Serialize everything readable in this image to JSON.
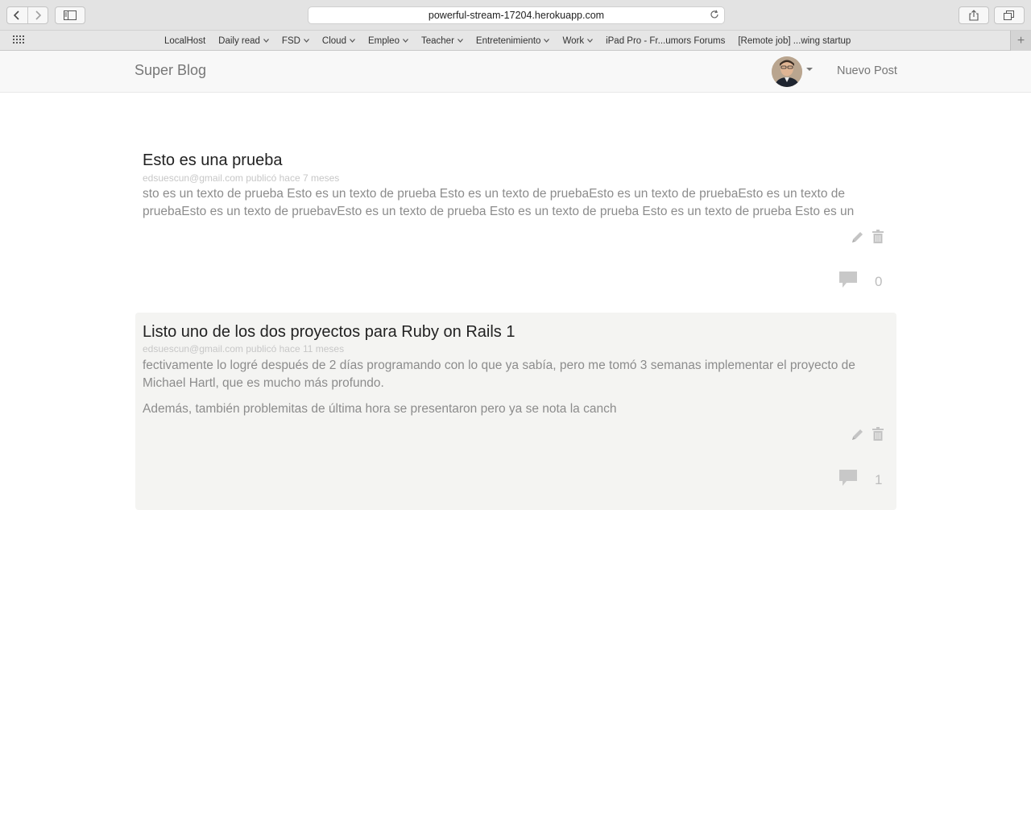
{
  "browser": {
    "url": "powerful-stream-17204.herokuapp.com",
    "bookmarks": [
      {
        "label": "LocalHost",
        "has_menu": false
      },
      {
        "label": "Daily read",
        "has_menu": true
      },
      {
        "label": "FSD",
        "has_menu": true
      },
      {
        "label": "Cloud",
        "has_menu": true
      },
      {
        "label": "Empleo",
        "has_menu": true
      },
      {
        "label": "Teacher",
        "has_menu": true
      },
      {
        "label": "Entretenimiento",
        "has_menu": true
      },
      {
        "label": "Work",
        "has_menu": true
      },
      {
        "label": "iPad Pro - Fr...umors Forums",
        "has_menu": false
      },
      {
        "label": "[Remote job] ...wing startup",
        "has_menu": false
      }
    ]
  },
  "app": {
    "brand": "Super Blog",
    "new_post_label": "Nuevo Post"
  },
  "posts": [
    {
      "title": "Esto es una prueba",
      "meta": "edsuescun@gmail.com publicó hace 7 meses",
      "paragraphs": [
        "sto es un texto de prueba Esto es un texto de prueba Esto es un texto de pruebaEsto es un texto de pruebaEsto es un texto de pruebaEsto es un texto de pruebavEsto es un texto de prueba Esto es un texto de prueba Esto es un texto de prueba Esto es un"
      ],
      "comment_count": "0"
    },
    {
      "title": "Listo uno de los dos proyectos para Ruby on Rails 1",
      "meta": "edsuescun@gmail.com publicó hace 11 meses",
      "paragraphs": [
        "fectivamente lo logré después de 2 días programando con lo que ya sabía, pero me tomó 3 semanas implementar el proyecto de Michael Hartl, que es mucho más profundo.",
        "Además, también problemitas de última hora se presentaron pero ya se nota la canch"
      ],
      "comment_count": "1"
    }
  ]
}
